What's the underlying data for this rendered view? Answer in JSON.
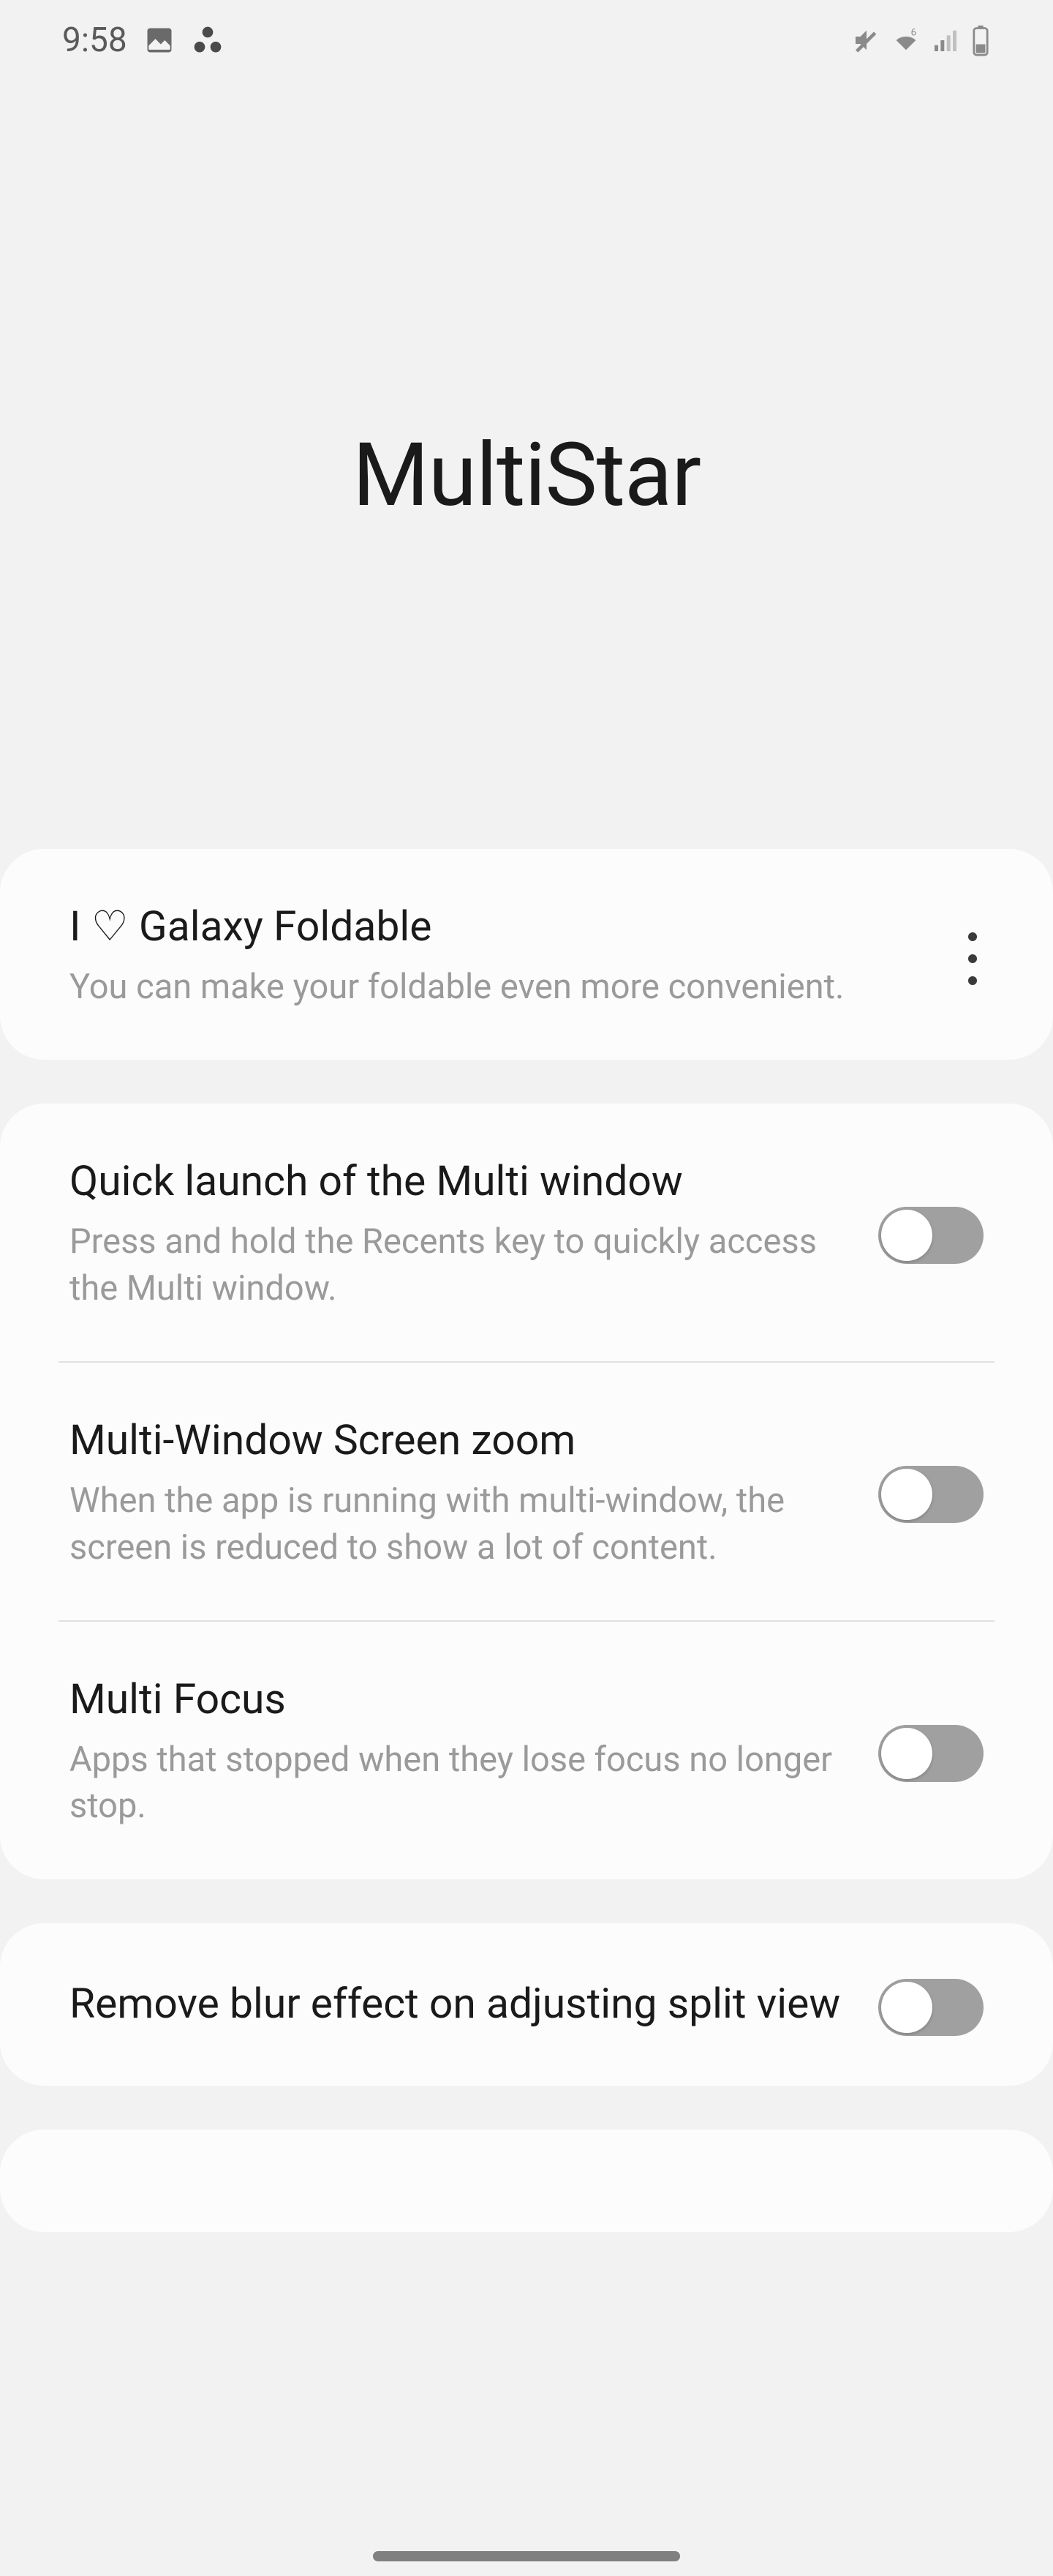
{
  "status": {
    "time": "9:58"
  },
  "header": {
    "title": "MultiStar"
  },
  "sections": {
    "foldable": {
      "title": "I ♡ Galaxy Foldable",
      "desc": "You can make your foldable even more convenient."
    },
    "quickLaunch": {
      "title": "Quick launch of the Multi window",
      "desc": "Press and hold the Recents key to quickly access the Multi window."
    },
    "screenZoom": {
      "title": "Multi-Window Screen zoom",
      "desc": "When the app is running with multi-window, the screen is reduced to show a lot of content."
    },
    "multiFocus": {
      "title": "Multi Focus",
      "desc": "Apps that stopped when they lose focus no longer stop."
    },
    "removeBlur": {
      "title": "Remove blur effect on adjusting split view"
    }
  }
}
